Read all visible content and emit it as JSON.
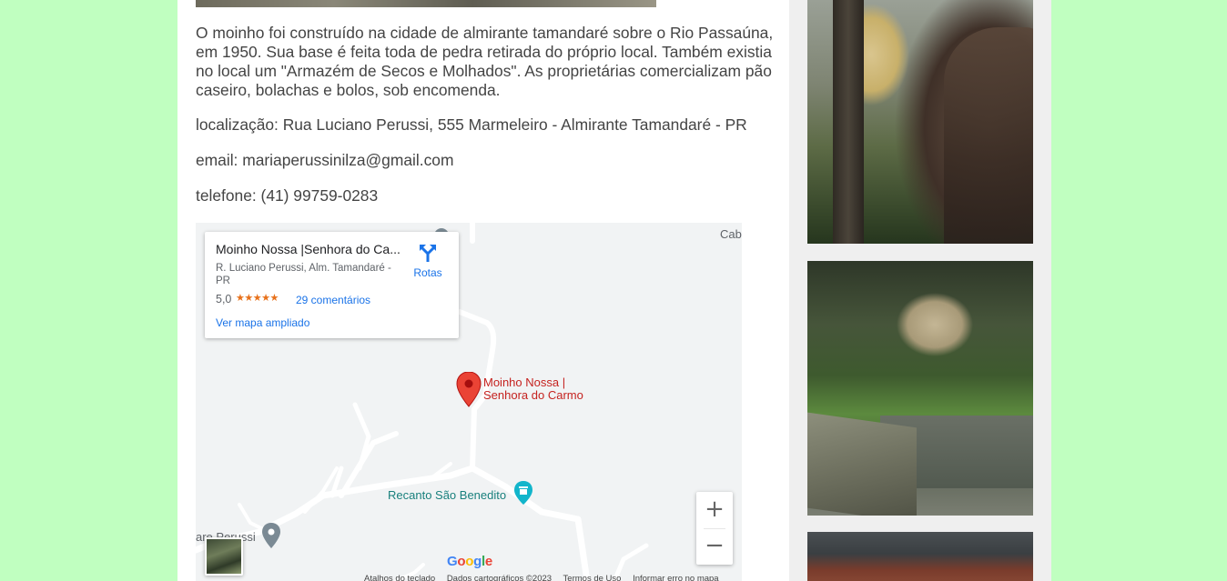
{
  "content": {
    "paragraph_1": "O moinho foi construído na cidade de almirante tamandaré sobre o Rio Passaúna, em 1950. Sua base é feita toda de pedra retirada do próprio local. Também existia no local um \"Armazém de Secos e Molhados\". As proprietárias comercializam pão caseiro, bolachas e bolos, sob encomenda.",
    "location": "localização: Rua Luciano Perussi, 555 Marmeleiro - Almirante Tamandaré - PR",
    "email": "email: mariaperussinilza@gmail.com",
    "phone": "telefone: (41) 99759-0283"
  },
  "map": {
    "card": {
      "title": "Moinho Nossa |Senhora do Ca...",
      "address": "R. Luciano Perussi, Alm. Tamandaré - PR",
      "rating": "5,0",
      "stars": "★★★★★",
      "reviews": "29 comentários",
      "view_larger": "Ver mapa ampliado",
      "directions": "Rotas"
    },
    "labels": {
      "main_place_line1": "Moinho Nossa |",
      "main_place_line2": "Senhora do Carmo",
      "recanto": "Recanto São Benedito",
      "perussi": "are Perussi",
      "cab": "Cab"
    },
    "zoom_in": "+",
    "zoom_out": "−",
    "google_logo": [
      "G",
      "o",
      "o",
      "g",
      "l",
      "e"
    ],
    "attribution": [
      "Atalhos do teclado",
      "Dados cartográficos ©2023",
      "Termos de Uso",
      "Informar erro no mapa"
    ],
    "colors": {
      "pin": "#ea4335",
      "link": "#1a73e8",
      "poi_teal": "#12b5cb",
      "stars": "#e7711b"
    }
  },
  "colors": {
    "page_bg": "#c0ffc0",
    "text": "#444444"
  }
}
